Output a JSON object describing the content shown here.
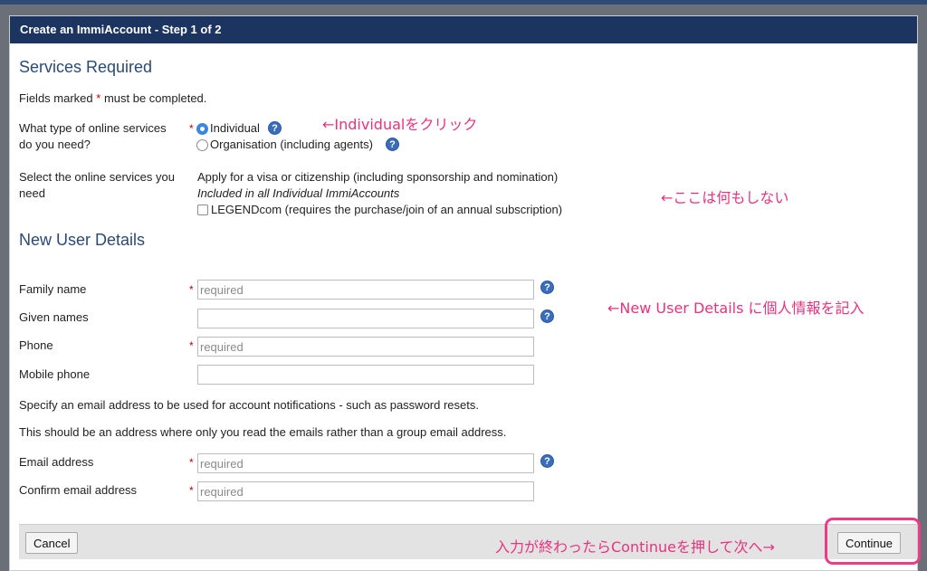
{
  "window": {
    "title": "Create an ImmiAccount - Step 1 of 2"
  },
  "services": {
    "heading": "Services Required",
    "required_note_pre": "Fields marked",
    "required_star": "*",
    "required_note_post": "must be completed.",
    "type_label_line1": "What type of online services",
    "type_label_line2": "do you need?",
    "option_individual": "Individual",
    "option_organisation": "Organisation (including agents)",
    "select_label_line1": "Select the online services you",
    "select_label_line2": "need",
    "apply_text": "Apply for a visa or citizenship (including sponsorship and nomination)",
    "included_text": "Included in all Individual ImmiAccounts",
    "legend_label": "LEGENDcom (requires the purchase/join of an annual subscription)"
  },
  "user_details": {
    "heading": "New User Details",
    "family_label": "Family name",
    "given_label": "Given names",
    "phone_label": "Phone",
    "mobile_label": "Mobile phone",
    "info_email": "Specify an email address to be used for account notifications - such as password resets.",
    "info_address": "This should be an address where only you read the emails rather than a group email address.",
    "email_label": "Email address",
    "confirm_label": "Confirm email address",
    "placeholder_required": "required",
    "help_glyph": "?"
  },
  "footer": {
    "cancel_label": "Cancel",
    "continue_label": "Continue"
  },
  "annotations": {
    "individual": "←Individualをクリック",
    "nothing": "←ここは何もしない",
    "details": "←New User Details に個人情報を記入",
    "continue": "入力が終わったらContinueを押して次へ→"
  },
  "colors": {
    "header_bg": "#1b3460",
    "heading_text": "#2b4a73",
    "annotation": "#e8337e",
    "help_icon": "#3a6cbc"
  }
}
